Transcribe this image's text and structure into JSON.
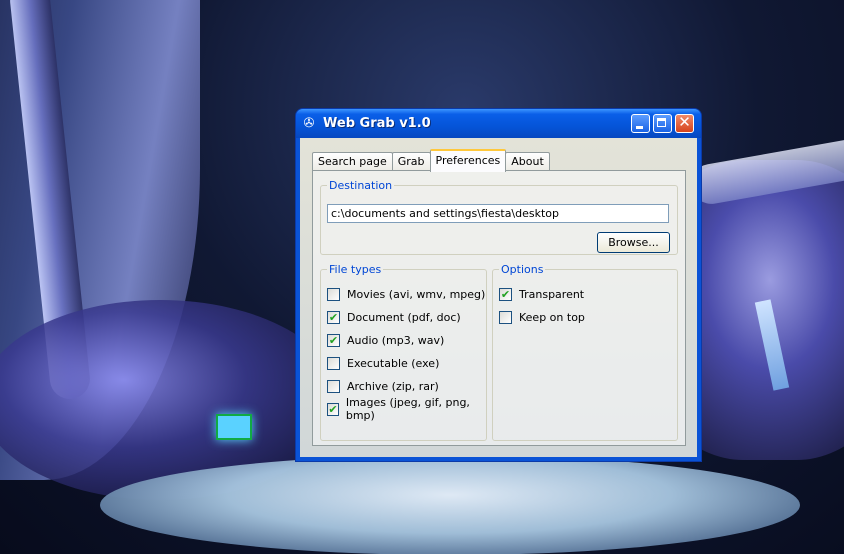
{
  "window": {
    "title": "Web Grab v1.0",
    "app_icon": "web-grab-app-icon",
    "controls": {
      "minimize": "minimize-icon",
      "maximize": "maximize-icon",
      "close": "close-icon"
    }
  },
  "tabs": [
    {
      "label": "Search page",
      "active": false
    },
    {
      "label": "Grab",
      "active": false
    },
    {
      "label": "Preferences",
      "active": true
    },
    {
      "label": "About",
      "active": false
    }
  ],
  "destination": {
    "legend": "Destination",
    "path": "c:\\documents and settings\\fiesta\\desktop",
    "browse_label": "Browse..."
  },
  "file_types": {
    "legend": "File types",
    "items": [
      {
        "label": "Movies (avi, wmv, mpeg)",
        "checked": false
      },
      {
        "label": "Document (pdf, doc)",
        "checked": true
      },
      {
        "label": "Audio (mp3, wav)",
        "checked": true
      },
      {
        "label": "Executable (exe)",
        "checked": false
      },
      {
        "label": "Archive (zip, rar)",
        "checked": false
      },
      {
        "label": "Images (jpeg, gif, png, bmp)",
        "checked": true
      }
    ]
  },
  "options": {
    "legend": "Options",
    "items": [
      {
        "label": "Transparent",
        "checked": true
      },
      {
        "label": "Keep on top",
        "checked": false
      }
    ]
  },
  "colors": {
    "titlebar": "#0554d8",
    "legend_text": "#0046d5",
    "active_tab_accent": "#ffc83c",
    "checkmark": "#21a121"
  }
}
